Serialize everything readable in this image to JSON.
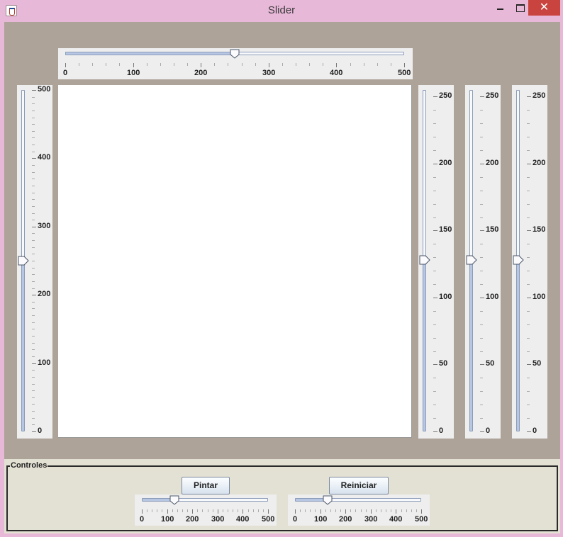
{
  "window": {
    "title": "Slider",
    "minimize_label": "",
    "maximize_label": "",
    "close_label": "✕"
  },
  "size_slider": {
    "min": 0,
    "max": 500,
    "value": 250,
    "labels": [
      "0",
      "100",
      "200",
      "300",
      "400",
      "500"
    ]
  },
  "vertical_slider": {
    "min": 0,
    "max": 500,
    "value": 250,
    "labels": [
      "0",
      "100",
      "200",
      "300",
      "400",
      "500"
    ]
  },
  "color_sliders": [
    {
      "min": 0,
      "max": 255,
      "value": 128,
      "labels": [
        "0",
        "50",
        "100",
        "150",
        "200",
        "250"
      ]
    },
    {
      "min": 0,
      "max": 255,
      "value": 128,
      "labels": [
        "0",
        "50",
        "100",
        "150",
        "200",
        "250"
      ]
    },
    {
      "min": 0,
      "max": 255,
      "value": 128,
      "labels": [
        "0",
        "50",
        "100",
        "150",
        "200",
        "250"
      ]
    }
  ],
  "controls": {
    "legend": "Controles",
    "paint_label": "Pintar",
    "reset_label": "Reiniciar",
    "slider_left": {
      "min": 0,
      "max": 500,
      "value": 130,
      "labels": [
        "0",
        "100",
        "200",
        "300",
        "400",
        "500"
      ]
    },
    "slider_right": {
      "min": 0,
      "max": 500,
      "value": 130,
      "labels": [
        "0",
        "100",
        "200",
        "300",
        "400",
        "500"
      ]
    }
  },
  "colors": {
    "title_bar": "#e8b8d8",
    "panel_bg": "#ada398",
    "controls_bg": "#e3e0d4",
    "close_button": "#c9443f",
    "track_fill": "#b7c7e3"
  }
}
